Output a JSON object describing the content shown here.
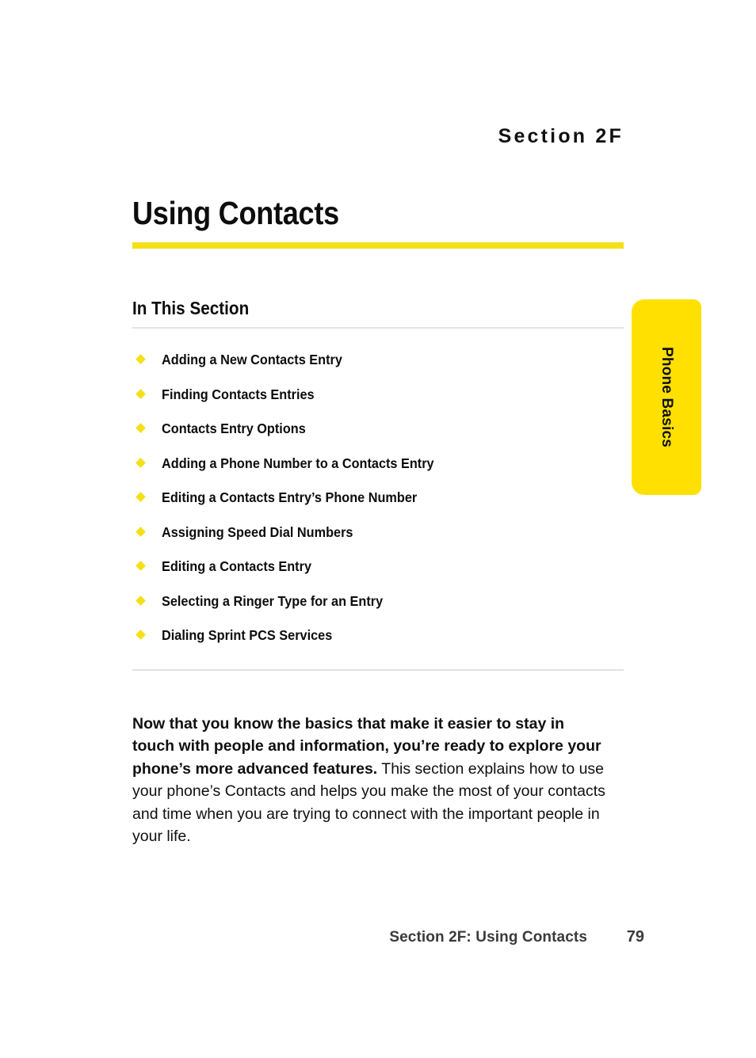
{
  "document": {
    "section_eyebrow": "Section 2F",
    "chapter_title": "Using Contacts",
    "subhead": "In This Section",
    "toc_items": [
      {
        "label": "Adding a New Contacts Entry"
      },
      {
        "label": "Finding Contacts Entries"
      },
      {
        "label": "Contacts Entry Options"
      },
      {
        "label": "Adding a Phone Number to a Contacts Entry"
      },
      {
        "label": "Editing a Contacts Entry’s Phone Number"
      },
      {
        "label": "Assigning Speed Dial Numbers"
      },
      {
        "label": "Editing a Contacts Entry"
      },
      {
        "label": "Selecting a Ringer Type for an Entry"
      },
      {
        "label": "Dialing Sprint PCS Services"
      }
    ],
    "intro": {
      "lead": "Now that you know the basics that make it easier to stay in touch with people and information, you’re ready to explore your phone’s more advanced features.",
      "rest": " This section explains how to use your phone’s Contacts and helps you make the most of your contacts and time when you are trying to connect with the important people in your life."
    }
  },
  "side_tab": {
    "label": "Phone Basics"
  },
  "footer": {
    "title": "Section 2F: Using Contacts",
    "page_number": "79"
  },
  "colors": {
    "accent_yellow": "#F5E017",
    "tab_yellow": "#FFE000",
    "rule_gray": "#E2E2E2",
    "body_text": "#101010",
    "footer_text": "#3a3a3a"
  }
}
